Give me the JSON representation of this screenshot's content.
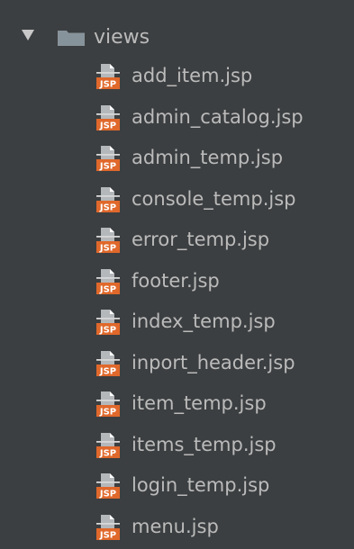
{
  "folder": {
    "name": "views",
    "expanded": true,
    "icon": "folder-icon",
    "toggle_icon": "triangle-down-icon"
  },
  "file_badge": "JSP",
  "files": [
    {
      "name": "add_item.jsp"
    },
    {
      "name": "admin_catalog.jsp"
    },
    {
      "name": "admin_temp.jsp"
    },
    {
      "name": "console_temp.jsp"
    },
    {
      "name": "error_temp.jsp"
    },
    {
      "name": "footer.jsp"
    },
    {
      "name": "index_temp.jsp"
    },
    {
      "name": "inport_header.jsp"
    },
    {
      "name": "item_temp.jsp"
    },
    {
      "name": "items_temp.jsp"
    },
    {
      "name": "login_temp.jsp"
    },
    {
      "name": "menu.jsp"
    }
  ],
  "colors": {
    "background": "#3c3f41",
    "text": "#bbbbbb",
    "folder": "#87939a",
    "jsp_badge": "#e0682b"
  }
}
